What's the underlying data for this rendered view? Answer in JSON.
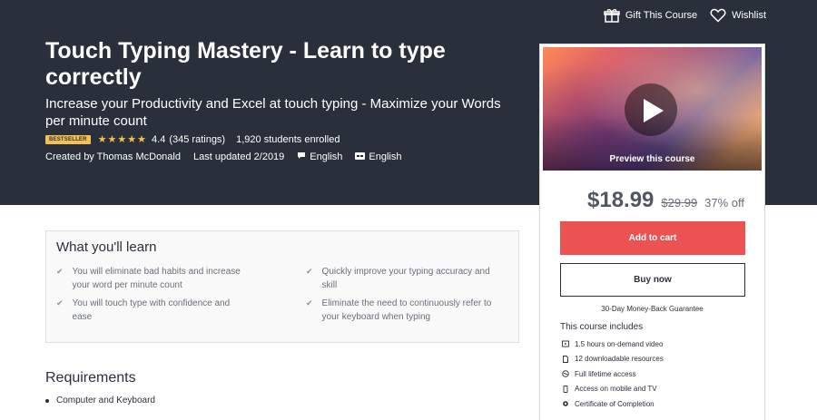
{
  "header": {
    "gift_label": "Gift This Course",
    "wishlist_label": "Wishlist",
    "title": "Touch Typing Mastery - Learn to type correctly",
    "subtitle": "Increase your Productivity and Excel at touch typing - Maximize your Words per minute count",
    "badge": "BESTSELLER",
    "rating_value": "4.4",
    "rating_count": "(345 ratings)",
    "students": "1,920 students enrolled",
    "created_by": "Created by Thomas McDonald",
    "last_updated": "Last updated 2/2019",
    "audio_language": "English",
    "caption_language": "English",
    "stars": 4.4,
    "icons": {
      "gift": "gift-icon",
      "wishlist": "heart-icon",
      "language": "speech-bubble-icon",
      "captions": "closed-captions-icon"
    }
  },
  "sidebar": {
    "preview_label": "Preview this course",
    "price": "$18.99",
    "original_price": "$29.99",
    "discount": "37% off",
    "add_to_cart": "Add to cart",
    "buy_now": "Buy now",
    "guarantee": "30-Day Money-Back Guarantee",
    "includes_title": "This course includes",
    "includes": [
      {
        "icon": "video-icon",
        "label": "1.5 hours on-demand video"
      },
      {
        "icon": "file-icon",
        "label": "12 downloadable resources"
      },
      {
        "icon": "infinity-icon",
        "label": "Full lifetime access"
      },
      {
        "icon": "mobile-icon",
        "label": "Access on mobile and TV"
      },
      {
        "icon": "certificate-icon",
        "label": "Certificate of Completion"
      }
    ]
  },
  "learn": {
    "title": "What you'll learn",
    "items": [
      "You will eliminate bad habits and increase your word per minute count",
      "Quickly improve your typing accuracy and skill",
      "You will touch type with confidence and ease",
      "Eliminate the need to continuously refer to your keyboard when typing"
    ]
  },
  "requirements": {
    "title": "Requirements",
    "items": [
      "Computer and Keyboard"
    ]
  },
  "colors": {
    "hero_bg": "#29303b",
    "accent_red": "#ec5252",
    "star_yellow": "#f4c150"
  }
}
